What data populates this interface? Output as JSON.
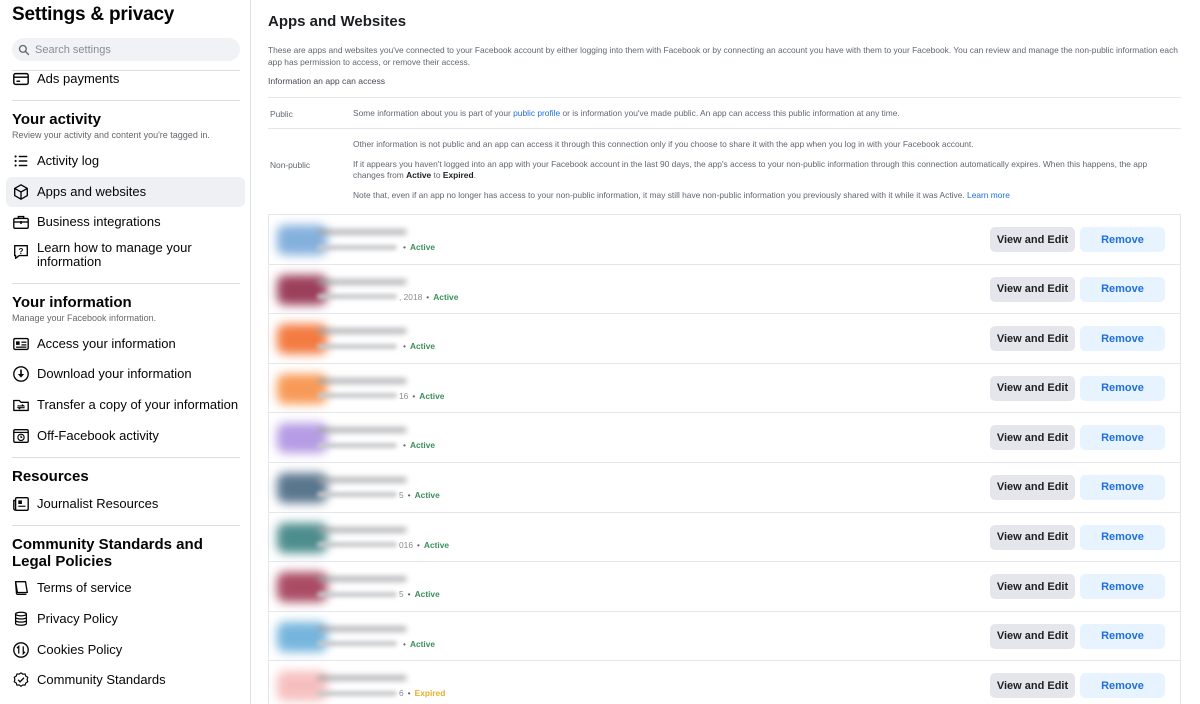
{
  "sidebar": {
    "title": "Settings & privacy",
    "search_placeholder": "Search settings",
    "top_item": {
      "label": "Ads payments",
      "icon": "credit-card-icon"
    },
    "sections": [
      {
        "title": "Your activity",
        "subtitle": "Review your activity and content you're tagged in.",
        "items": [
          {
            "label": "Activity log",
            "icon": "list-icon",
            "active": false
          },
          {
            "label": "Apps and websites",
            "icon": "cube-icon",
            "active": true
          },
          {
            "label": "Business integrations",
            "icon": "briefcase-icon",
            "active": false
          },
          {
            "label": "Learn how to manage your information",
            "icon": "question-bubble-icon",
            "active": false
          }
        ]
      },
      {
        "title": "Your information",
        "subtitle": "Manage your Facebook information.",
        "items": [
          {
            "label": "Access your information",
            "icon": "id-card-icon"
          },
          {
            "label": "Download your information",
            "icon": "download-circle-icon"
          },
          {
            "label": "Transfer a copy of your information",
            "icon": "folder-transfer-icon"
          },
          {
            "label": "Off-Facebook activity",
            "icon": "history-icon"
          }
        ]
      },
      {
        "title": "Resources",
        "items": [
          {
            "label": "Journalist Resources",
            "icon": "newspaper-icon"
          }
        ]
      },
      {
        "title": "Community Standards and Legal Policies",
        "items": [
          {
            "label": "Terms of service",
            "icon": "book-icon"
          },
          {
            "label": "Privacy Policy",
            "icon": "database-icon"
          },
          {
            "label": "Cookies Policy",
            "icon": "cookie-arrows-icon"
          },
          {
            "label": "Community Standards",
            "icon": "badge-check-icon"
          }
        ]
      }
    ]
  },
  "main": {
    "title": "Apps and Websites",
    "intro": "These are apps and websites you've connected to your Facebook account by either logging into them with Facebook or by connecting an account you have with them to your Facebook. You can review and manage the non-public information each app has permission to access, or remove their access.",
    "info_heading": "Information an app can access",
    "public": {
      "label": "Public",
      "text_before": "Some information about you is part of your ",
      "link": "public profile",
      "text_after": " or is information you've made public. An app can access this public information at any time."
    },
    "non_public": {
      "label": "Non-public",
      "p1": "Other information is not public and an app can access it through this connection only if you choose to share it with the app when you log in with your Facebook account.",
      "p2_before": "If it appears you haven't logged into an app with your Facebook account in the last 90 days, the app's access to your non-public information through this connection automatically expires. When this happens, the app changes from ",
      "p2_active": "Active",
      "p2_mid": " to ",
      "p2_expired": "Expired",
      "p2_end": ".",
      "p3": "Note that, even if an app no longer has access to your non-public information, it may still have non-public information you previously shared with it while it was Active. ",
      "p3_link": "Learn more"
    },
    "view_label": "View and Edit",
    "remove_label": "Remove",
    "apps": [
      {
        "date_fragment": "",
        "status": "Active",
        "icon_color": "#6fa3d8"
      },
      {
        "date_fragment": ", 2018",
        "status": "Active",
        "icon_color": "#8b1e3f"
      },
      {
        "date_fragment": "",
        "status": "Active",
        "icon_color": "#f26522"
      },
      {
        "date_fragment": "16",
        "status": "Active",
        "icon_color": "#f7893a"
      },
      {
        "date_fragment": "",
        "status": "Active",
        "icon_color": "#a98be0"
      },
      {
        "date_fragment": "5",
        "status": "Active",
        "icon_color": "#3e5f7a"
      },
      {
        "date_fragment": "016",
        "status": "Active",
        "icon_color": "#2f7a7a"
      },
      {
        "date_fragment": "5",
        "status": "Active",
        "icon_color": "#9c2d4a"
      },
      {
        "date_fragment": "",
        "status": "Active",
        "icon_color": "#5fa9d8"
      },
      {
        "date_fragment": "6",
        "status": "Expired",
        "icon_color": "#f5b5b5"
      }
    ]
  }
}
